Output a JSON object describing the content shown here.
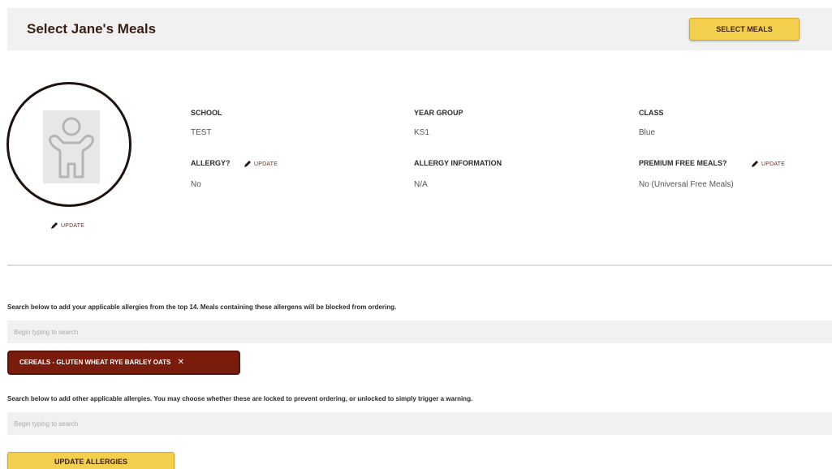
{
  "header": {
    "title": "Select Jane's Meals",
    "select_meals_label": "SELECT MEALS"
  },
  "profile": {
    "avatar_icon": "child-figure-icon",
    "update_label": "UPDATE"
  },
  "fields": {
    "school": {
      "label": "SCHOOL",
      "value": "TEST"
    },
    "year_group": {
      "label": "YEAR GROUP",
      "value": "KS1"
    },
    "class": {
      "label": "CLASS",
      "value": "Blue"
    },
    "allergy": {
      "label": "ALLERGY?",
      "value": "No",
      "update_label": "UPDATE"
    },
    "allergy_information": {
      "label": "ALLERGY INFORMATION",
      "value": "N/A"
    },
    "premium_free_meals": {
      "label": "PREMIUM FREE MEALS?",
      "value": "No (Universal Free Meals)",
      "update_label": "UPDATE"
    }
  },
  "allergies": {
    "top14_help": "Search below to add your applicable allergies from the top 14. Meals containing these allergens will be blocked from ordering.",
    "top14_placeholder": "Begin typing to search",
    "selected_chips": [
      {
        "label": "CEREALS - GLUTEN WHEAT RYE BARLEY OATS",
        "remove": "✕"
      }
    ],
    "other_help": "Search below to add other applicable allergies. You may choose whether these are locked to prevent ordering, or unlocked to simply trigger a warning.",
    "other_placeholder": "Begin typing to search",
    "update_button_label": "UPDATE ALLERGIES"
  },
  "colors": {
    "accent_gold": "#f3cf4e",
    "brand_maroon": "#7a1c0c",
    "title_brown": "#3c1f14"
  }
}
